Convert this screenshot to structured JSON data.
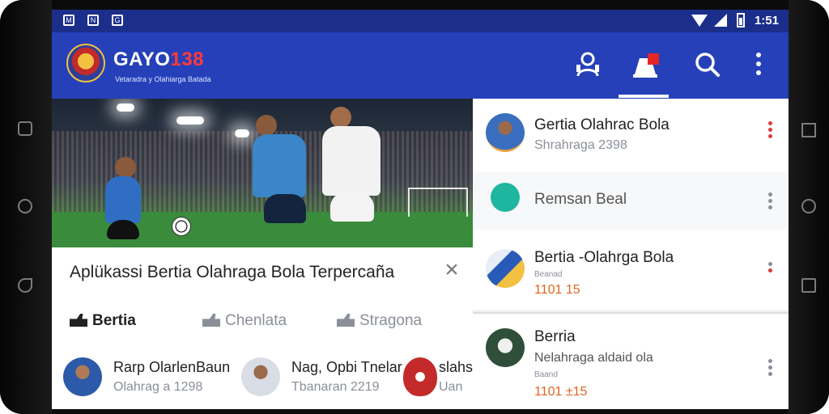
{
  "statusbar": {
    "time": "1:51",
    "icons": [
      "notification-icon",
      "notification-icon",
      "notification-icon"
    ],
    "icon_glyphs": [
      "M",
      "N",
      "G"
    ]
  },
  "appbar": {
    "brand_main": "GAYO",
    "brand_accent": "138",
    "tagline": "Vetaradra y Olahiarga Batada",
    "actions": [
      "support-icon",
      "notifications-icon",
      "search-icon",
      "more-vert-icon"
    ]
  },
  "headline": {
    "title": "Aplükassi Bertia Olahraga Bola Terpercaña"
  },
  "tabs": [
    {
      "label": "Bertia",
      "active": true
    },
    {
      "label": "Chenlata",
      "active": false
    },
    {
      "label": "Stragona",
      "active": false
    }
  ],
  "news": [
    {
      "title": "Rarp OlarlenBaun",
      "subtitle": "Olahrag a 1298"
    },
    {
      "title": "Nag, Opbi Tnelar",
      "subtitle": "Tbanaran 2219"
    },
    {
      "title": "slahs",
      "subtitle": "Uan"
    }
  ],
  "side_cards": [
    {
      "title": "Gertia Olahrac Bola",
      "subtitle": "Shrahraga 2398"
    },
    {
      "title": "Remsan Beal"
    },
    {
      "title": "Bertia -Olahrga Bola",
      "small": "Beanad",
      "meta": "1101 15"
    },
    {
      "title": "Berria",
      "subtitle": "Nelahraga aldaid ola",
      "small": "Baand",
      "meta": "1101 ±15"
    }
  ],
  "colors": {
    "brand_blue": "#2540b8",
    "status_blue": "#1b2f8a",
    "accent_red": "#ff3a3a",
    "meta_orange": "#e0661e",
    "kebab_red": "#e03a3a",
    "kebab_gray": "#8a8f99",
    "teal": "#1fb6a0"
  }
}
